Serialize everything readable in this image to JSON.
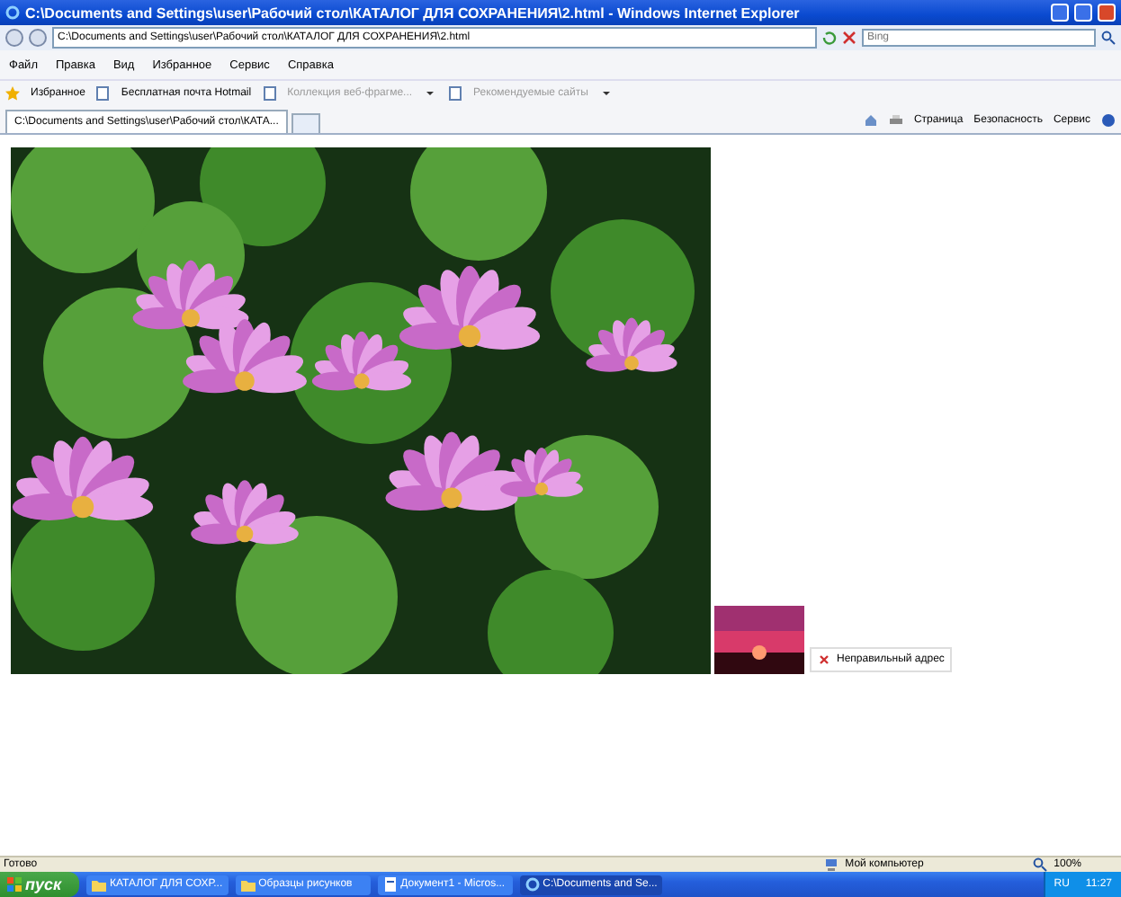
{
  "window": {
    "title": "C:\\Documents and Settings\\user\\Рабочий стол\\КАТАЛОГ ДЛЯ СОХРАНЕНИЯ\\2.html - Windows Internet Explorer"
  },
  "address_bar": {
    "value": "C:\\Documents and Settings\\user\\Рабочий стол\\КАТАЛОГ ДЛЯ СОХРАНЕНИЯ\\2.html",
    "search_placeholder": "Bing"
  },
  "menu": [
    "Файл",
    "Правка",
    "Вид",
    "Избранное",
    "Сервис",
    "Справка"
  ],
  "favorites_bar": {
    "label": "Избранное",
    "items": [
      {
        "label": "Бесплатная почта Hotmail",
        "disabled": false,
        "dropdown": false
      },
      {
        "label": "Коллекция веб-фрагме...",
        "disabled": true,
        "dropdown": true
      },
      {
        "label": "Рекомендуемые сайты",
        "disabled": true,
        "dropdown": true
      }
    ]
  },
  "tabs": [
    {
      "label": "C:\\Documents and Settings\\user\\Рабочий стол\\КАТА...",
      "selected": true
    }
  ],
  "command_bar": [
    "Страница",
    "Безопасность",
    "Сервис"
  ],
  "content": {
    "broken_image_text": "Неправильный адрес"
  },
  "status_bar": {
    "status": "Готово",
    "zone": "Мой компьютер",
    "zoom": "100%"
  },
  "taskbar": {
    "start": "пуск",
    "tasks": [
      {
        "label": "КАТАЛОГ ДЛЯ СОХР...",
        "kind": "folder",
        "selected": false
      },
      {
        "label": "Образцы рисунков",
        "kind": "folder",
        "selected": false
      },
      {
        "label": "Документ1 - Micros...",
        "kind": "document",
        "selected": false
      },
      {
        "label": "C:\\Documents and Se...",
        "kind": "browser",
        "selected": true
      }
    ],
    "language": "RU",
    "clock": "11:27"
  }
}
